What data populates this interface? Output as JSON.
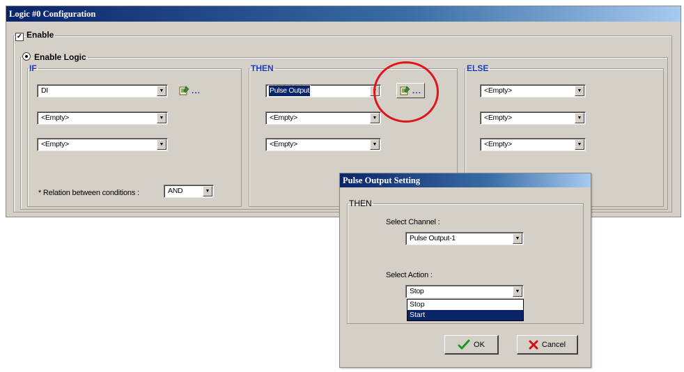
{
  "main_window": {
    "title": "Logic #0 Configuration",
    "enable_label": "Enable",
    "enable_logic_label": "Enable Logic",
    "if_section": {
      "legend": "IF",
      "conditions": [
        "DI",
        "<Empty>",
        "<Empty>"
      ],
      "wizard_dots": "...",
      "relation_label": "* Relation between conditions :",
      "relation_value": "AND"
    },
    "then_section": {
      "legend": "THEN",
      "actions": [
        "Pulse Output",
        "<Empty>",
        "<Empty>"
      ],
      "wizard_dots": "..."
    },
    "else_section": {
      "legend": "ELSE",
      "actions": [
        "<Empty>",
        "<Empty>",
        "<Empty>"
      ]
    }
  },
  "pulse_dialog": {
    "title": "Pulse Output Setting",
    "group_legend": "THEN",
    "channel_label": "Select Channel :",
    "channel_value": "Pulse Output-1",
    "action_label": "Select Action :",
    "action_value": "Stop",
    "action_options": [
      "Stop",
      "Start"
    ],
    "ok_label": "OK",
    "cancel_label": "Cancel"
  },
  "colors": {
    "accent_blue": "#1a3cc0",
    "highlight_circle": "#e0141a",
    "selection": "#0a246a",
    "dialog_face": "#d4d0c8"
  }
}
